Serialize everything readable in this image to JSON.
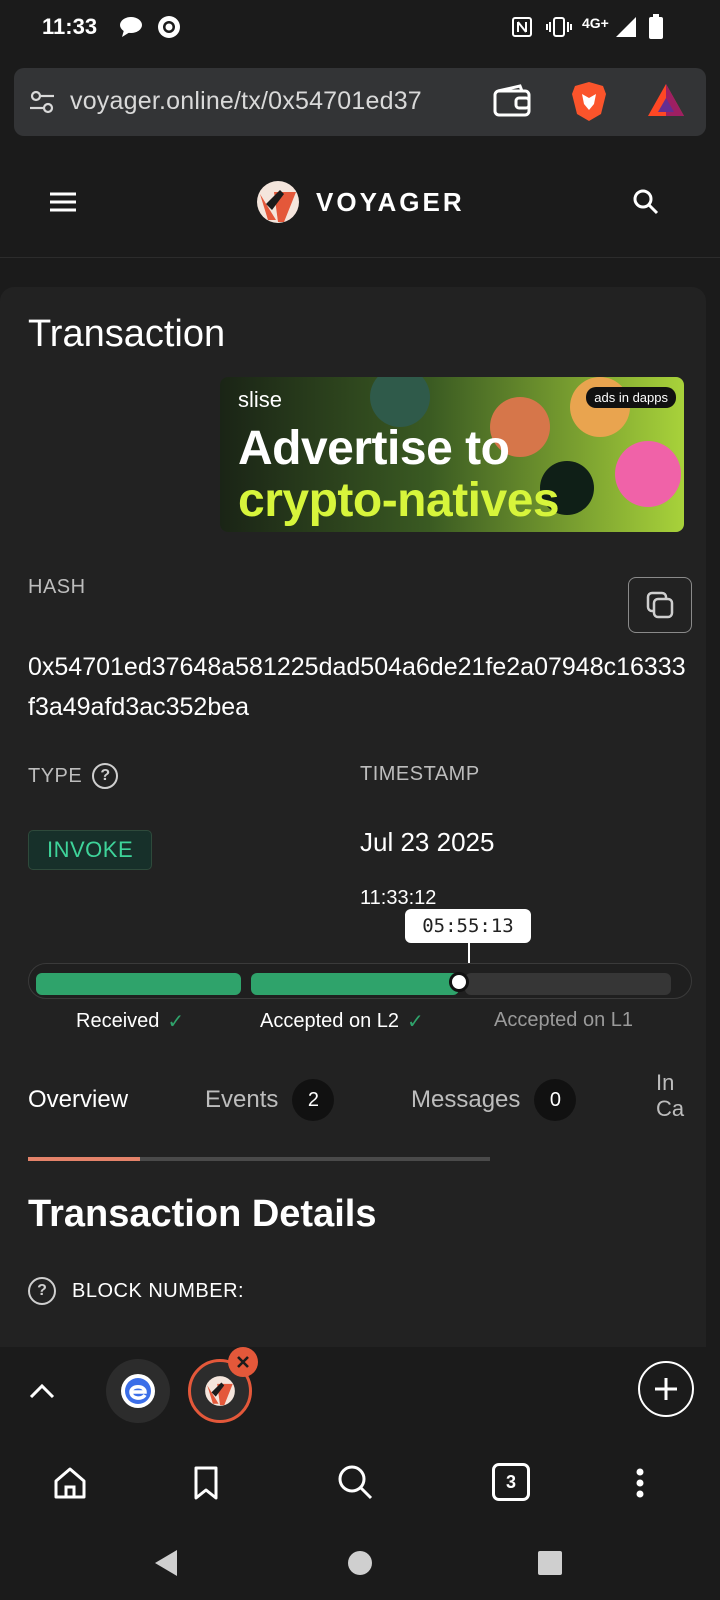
{
  "status_bar": {
    "time": "11:33",
    "network": "4G+"
  },
  "browser": {
    "url": "voyager.online/tx/0x54701ed37",
    "tab_count": "3"
  },
  "site": {
    "logo_text": "VOYAGER"
  },
  "page": {
    "title": "Transaction"
  },
  "ad": {
    "brand": "slise",
    "line1": "Advertise to",
    "line2": "crypto-natives",
    "tag": "ads in dapps"
  },
  "transaction": {
    "hash_label": "HASH",
    "hash": "0x54701ed37648a581225dad504a6de21fe2a07948c16333f3a49afd3ac352bea",
    "type_label": "TYPE",
    "type": "INVOKE",
    "timestamp_label": "TIMESTAMP",
    "date": "Jul 23 2025",
    "time": "11:33:12",
    "elapsed": "05:55:13"
  },
  "stages": [
    {
      "label": "Received",
      "done": true
    },
    {
      "label": "Accepted on L2",
      "done": true
    },
    {
      "label": "Accepted on L1",
      "done": false
    }
  ],
  "tabs": [
    {
      "label": "Overview",
      "count": null,
      "active": true
    },
    {
      "label": "Events",
      "count": "2",
      "active": false
    },
    {
      "label": "Messages",
      "count": "0",
      "active": false
    },
    {
      "label": "In",
      "label2": "Ca",
      "active": false
    }
  ],
  "details": {
    "title": "Transaction Details",
    "block_number_label": "BLOCK NUMBER:"
  },
  "colors": {
    "accent_green": "#2fa36b",
    "invoke_text": "#3ed49a",
    "tab_indicator": "#e4836a",
    "voyager_orange": "#e4583a"
  }
}
